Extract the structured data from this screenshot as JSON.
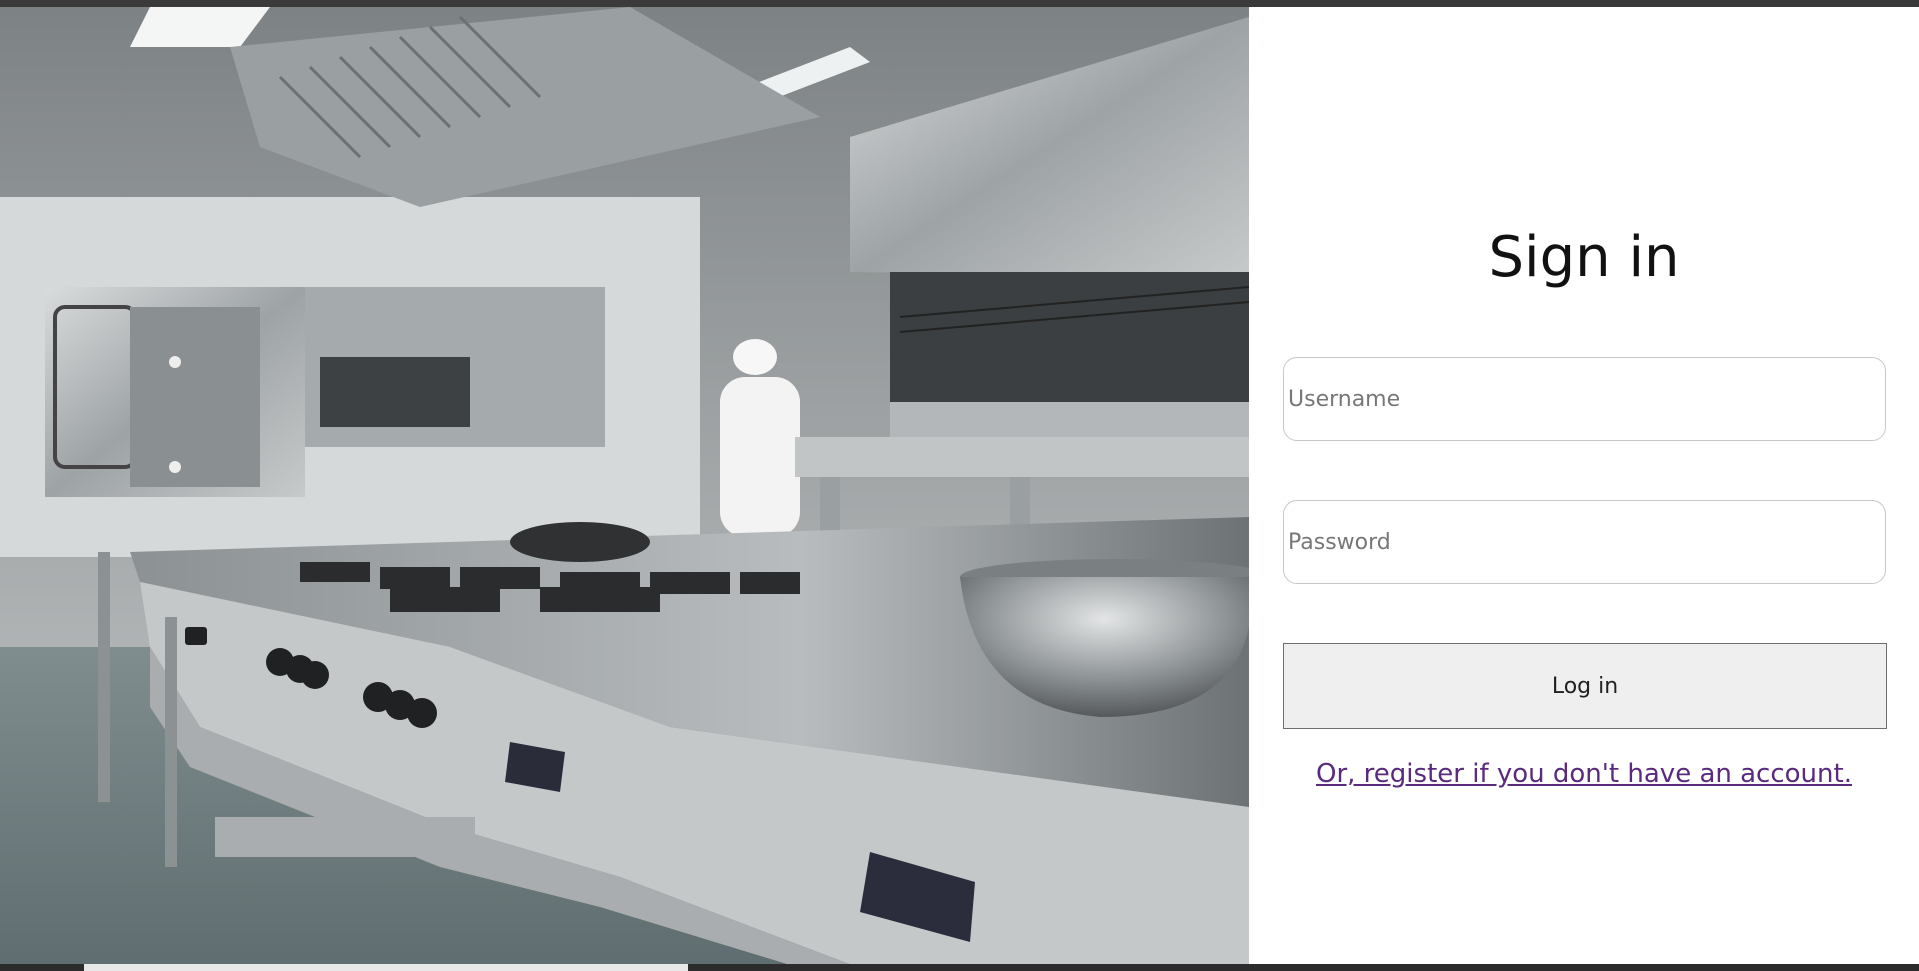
{
  "hero": {
    "image_description_icon": "kitchen-photo"
  },
  "login": {
    "title": "Sign in",
    "username_placeholder": "Username",
    "password_placeholder": "Password",
    "login_button_label": "Log in",
    "register_link_text": "Or, register if you don't have an account."
  },
  "colors": {
    "link": "#5a2a7e",
    "button_bg": "#efefef",
    "button_border": "#6f6f6f",
    "field_border": "#c8c8c8"
  }
}
